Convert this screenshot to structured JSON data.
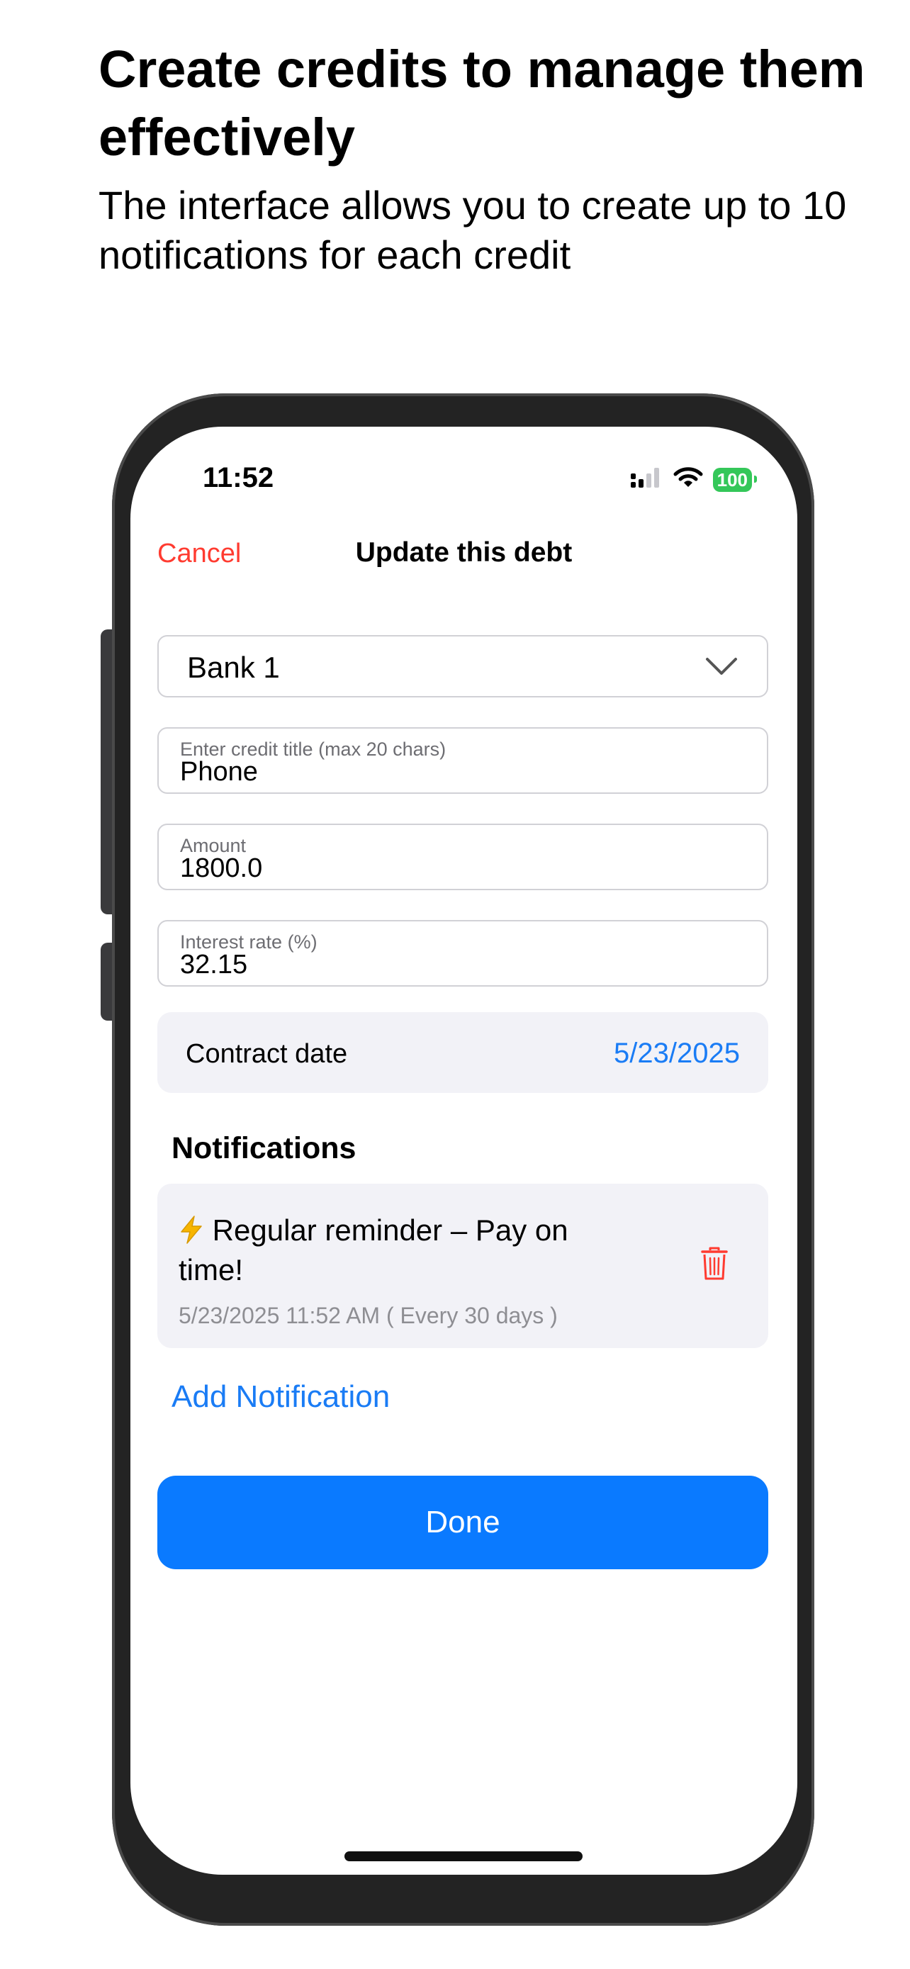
{
  "promo": {
    "headline": "Create credits to manage them effectively",
    "subline": "The interface allows you to create up to 10 notifications for each credit"
  },
  "status_bar": {
    "time": "11:52",
    "battery": "100",
    "icons": [
      "signal-icon",
      "wifi-icon",
      "battery-icon"
    ]
  },
  "nav": {
    "cancel_label": "Cancel",
    "title": "Update this debt"
  },
  "form": {
    "bank_select": {
      "value": "Bank 1"
    },
    "title_field": {
      "label": "Enter credit title (max 20 chars)",
      "value": "Phone"
    },
    "amount_field": {
      "label": "Amount",
      "value": "1800.0"
    },
    "rate_field": {
      "label": "Interest rate (%)",
      "value": "32.15"
    },
    "contract_date": {
      "label": "Contract date",
      "value": "5/23/2025"
    }
  },
  "notifications": {
    "heading": "Notifications",
    "items": [
      {
        "icon": "lightning-icon",
        "title": "Regular reminder – Pay on time!",
        "subtitle": "5/23/2025 11:52 AM ( Every 30 days )"
      }
    ],
    "add_label": "Add Notification"
  },
  "actions": {
    "done_label": "Done"
  },
  "colors": {
    "accent": "#1a7cf5",
    "primary_button": "#0a7aff",
    "destructive": "#ff3b30",
    "battery": "#34c759"
  }
}
